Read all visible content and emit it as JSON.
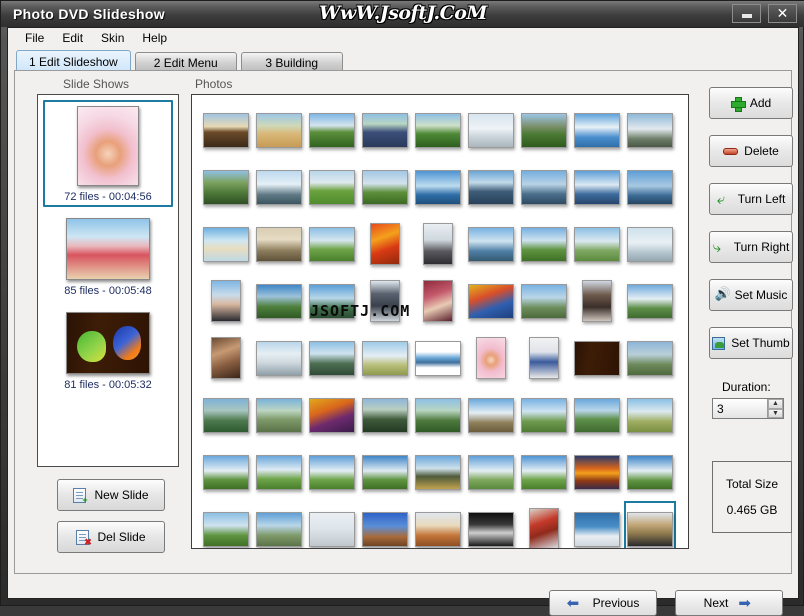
{
  "window": {
    "title": "Photo DVD Slideshow",
    "watermark_top": "WwW.JsoftJ.CoM",
    "watermark_grid": "JSOFTJ.COM",
    "minimize_label": "minimize",
    "close_label": "✕"
  },
  "menu": {
    "items": [
      "File",
      "Edit",
      "Skin",
      "Help"
    ]
  },
  "tabs": [
    {
      "label": "1 Edit Slideshow",
      "active": true
    },
    {
      "label": "2 Edit Menu",
      "active": false
    },
    {
      "label": "3 Building",
      "active": false
    }
  ],
  "labels": {
    "slideshows": "Slide Shows",
    "photos": "Photos"
  },
  "slideshows": [
    {
      "caption": "72 files - 00:04:56",
      "selected": true,
      "thumb": "girl-portrait",
      "orientation": "portrait"
    },
    {
      "caption": "85 files - 00:05:48",
      "selected": false,
      "thumb": "beach-couple",
      "orientation": "landscape"
    },
    {
      "caption": "81 files - 00:05:32",
      "selected": false,
      "thumb": "parrots",
      "orientation": "landscape"
    }
  ],
  "left_buttons": [
    {
      "label": "New Slide",
      "icon": "new-document-icon"
    },
    {
      "label": "Del Slide",
      "icon": "delete-document-icon"
    }
  ],
  "right_buttons": [
    {
      "label": "Add",
      "icon": "plus-icon"
    },
    {
      "label": "Delete",
      "icon": "minus-icon"
    },
    {
      "label": "Turn Left",
      "icon": "arrow-left-icon"
    },
    {
      "label": "Turn Right",
      "icon": "arrow-right-icon"
    },
    {
      "label": "Set Music",
      "icon": "speaker-icon"
    },
    {
      "label": "Set Thumb",
      "icon": "thumbnail-icon"
    }
  ],
  "duration": {
    "label": "Duration:",
    "value": "3",
    "spin_up": "▲",
    "spin_down": "▼"
  },
  "total_size": {
    "title": "Total Size",
    "value": "0.465 GB"
  },
  "nav": {
    "previous": "Previous",
    "next": "Next"
  },
  "photo_grid": {
    "columns": 9,
    "rows": 8,
    "count": 72,
    "selected_index": 71,
    "cells": [
      {
        "o": "land",
        "c": "linear-gradient(180deg,#9fc4e2 0%,#e8d9b4 38%,#6b4a2a 55%,#3b2a18 100%)"
      },
      {
        "o": "land",
        "c": "linear-gradient(180deg,#9cc6e6 0%,#cfd9b9 35%,#d9b878 60%,#c79b55 100%)"
      },
      {
        "o": "land",
        "c": "linear-gradient(180deg,#7fb6e4 0%,#d5e4ef 35%,#5c8f3a 55%,#2f6320 100%)"
      },
      {
        "o": "land",
        "c": "linear-gradient(180deg,#8dc0e3 0%,#b9d6c2 30%,#3c4f7a 55%,#2a3a5c 100%)"
      },
      {
        "o": "land",
        "c": "linear-gradient(180deg,#8dc0e3 0%,#cfe0c9 35%,#4e8a36 60%,#2d5e1f 100%)"
      },
      {
        "o": "land",
        "c": "linear-gradient(180deg,#d8e4ee 0%,#eef3f7 45%,#c9d3d9 70%,#aab6bd 100%)"
      },
      {
        "o": "land",
        "c": "linear-gradient(180deg,#9cc6e6 0%,#7a8f6a 38%,#4b7a33 62%,#2e5a1e 100%)"
      },
      {
        "o": "land",
        "c": "linear-gradient(180deg,#5fa3dc 0%,#e9f1f6 40%,#4b8fd0 70%,#2f6ea8 100%)"
      },
      {
        "o": "land",
        "c": "linear-gradient(180deg,#8db8d8 0%,#e2e9ee 45%,#6e7f6a 75%,#4a5744 100%)"
      },
      {
        "o": "land",
        "c": "linear-gradient(180deg,#8fc0e2 0%,#7da25e 35%,#4e7a3a 65%,#2e4f24 100%)"
      },
      {
        "o": "land",
        "c": "linear-gradient(180deg,#bcd9ef 0%,#e5eff6 40%,#5f7a86 72%,#3a5460 100%)"
      },
      {
        "o": "land",
        "c": "linear-gradient(180deg,#b9d6ea 0%,#dfe9ef 35%,#6ba23f 60%,#4f8c2d 100%)"
      },
      {
        "o": "land",
        "c": "linear-gradient(180deg,#a3c8e4 0%,#d3e2ec 38%,#5c8f3a 65%,#3b6a24 100%)"
      },
      {
        "o": "land",
        "c": "linear-gradient(180deg,#4e94d4 0%,#bddcee 45%,#2f6ea8 72%,#1f4f7c 100%)"
      },
      {
        "o": "land",
        "c": "linear-gradient(180deg,#6aa5d6 0%,#c3dbea 35%,#3e5d78 62%,#27405a 100%)"
      },
      {
        "o": "land",
        "c": "linear-gradient(180deg,#74aede 0%,#b9d3e6 40%,#4a6f8c 70%,#2e4a62 100%)"
      },
      {
        "o": "land",
        "c": "linear-gradient(180deg,#5e9fd8 0%,#dbe9f3 42%,#3d6c9c 70%,#27456c 100%)"
      },
      {
        "o": "land",
        "c": "linear-gradient(180deg,#5d9ed6 0%,#a8c9e2 45%,#3b6a94 75%,#254662 100%)"
      },
      {
        "o": "land",
        "c": "linear-gradient(180deg,#6fb1e0 0%,#cfe7f2 38%,#e8ddc0 62%,#bfd9e6 100%)"
      },
      {
        "o": "land",
        "c": "linear-gradient(180deg,#d9cdb2 0%,#e6dcc4 35%,#8f7f5e 68%,#5e5238 100%)"
      },
      {
        "o": "land",
        "c": "linear-gradient(180deg,#8cc0e4 0%,#d6e6ef 38%,#6ea449 65%,#4a7f2c 100%)"
      },
      {
        "o": "port",
        "c": "linear-gradient(160deg,#e84b1c 0%,#f4a11c 35%,#d93a14 62%,#8f2a0c 100%)"
      },
      {
        "o": "port",
        "c": "linear-gradient(180deg,#e9eef2 0%,#cfd8de 40%,#5a5a5e 68%,#2e2e32 100%)"
      },
      {
        "o": "land",
        "c": "linear-gradient(180deg,#79b2e2 0%,#cfe4f0 40%,#4f7fa6 70%,#33596f 100%)"
      },
      {
        "o": "land",
        "c": "linear-gradient(180deg,#77b0e0 0%,#cfe3ef 38%,#5e9440 66%,#3f7026 100%)"
      },
      {
        "o": "land",
        "c": "linear-gradient(180deg,#8cc0e4 0%,#dbe9f0 40%,#7fa862 68%,#5a8a3e 100%)"
      },
      {
        "o": "land",
        "c": "linear-gradient(180deg,#cfe1ec 0%,#e9f0f4 45%,#b9c9d2 72%,#94a6b0 100%)"
      },
      {
        "o": "port",
        "c": "linear-gradient(180deg,#7fb5e2 0%,#c8dcea 35%,#d9b8a0 58%,#2a2a30 100%)"
      },
      {
        "o": "land",
        "c": "linear-gradient(180deg,#3f86c8 0%,#9cc2d8 35%,#4e7f3c 66%,#2f5a24 100%)"
      },
      {
        "o": "land",
        "c": "linear-gradient(180deg,#59a0d8 0%,#b8d6e8 40%,#3f6f4a 70%,#2a4c32 100%)"
      },
      {
        "o": "port",
        "c": "linear-gradient(180deg,#dfe7ee 0%,#5a6270 32%,#3a414c 62%,#cfd6dc 100%)"
      },
      {
        "o": "port",
        "c": "linear-gradient(160deg,#8e2b3c 0%,#c45a6c 35%,#e8cbb4 62%,#5a1f2c 100%)"
      },
      {
        "o": "land",
        "c": "linear-gradient(160deg,#e2b31c 0%,#d94e2a 35%,#2f5fb0 65%,#1f3f7c 100%)"
      },
      {
        "o": "land",
        "c": "linear-gradient(180deg,#79b2e2 0%,#b9d6e8 38%,#6e8f5c 68%,#4a6a3c 100%)"
      },
      {
        "o": "port",
        "c": "linear-gradient(180deg,#cfd8e2 0%,#6e5a4c 35%,#3a2e28 65%,#cfc6be 100%)"
      },
      {
        "o": "land",
        "c": "linear-gradient(180deg,#6fa9dc 0%,#e4eef4 42%,#5e8f4a 70%,#3f6a30 100%)"
      },
      {
        "o": "port",
        "c": "linear-gradient(160deg,#6b4a34 0%,#c79a74 35%,#8a5f42 62%,#3a2618 100%)"
      },
      {
        "o": "land",
        "c": "linear-gradient(180deg,#b9d6ea 0%,#e6eef4 35%,#cfd9de 62%,#8fa0aa 100%)"
      },
      {
        "o": "land",
        "c": "linear-gradient(180deg,#8cc0e4 0%,#cfe3ef 35%,#4e6f52 65%,#2f4a36 100%)"
      },
      {
        "o": "land",
        "c": "linear-gradient(180deg,#9ecbe8 0%,#e4eef4 42%,#b9bf7a 70%,#8f9a4e 100%)"
      },
      {
        "o": "land",
        "c": "linear-gradient(180deg,#ffffff 0%,#ffffff 30%,#6aa8d8 48%,#3f6f9c 62%,#ffffff 78%)"
      },
      {
        "o": "port",
        "c": "radial-gradient(circle at 50% 55%,#f7d6bc 0%,#e8a07a 20%,#f2bccd 45%,#f8dde8 100%)"
      },
      {
        "o": "port",
        "c": "linear-gradient(180deg,#f2f2f2 0%,#dfe4ea 35%,#3a5a9c 60%,#e8e8e8 100%)"
      },
      {
        "o": "land",
        "c": "linear-gradient(100deg,#2a1205 0%,#3d1d06 35%,#2e1304 100%)"
      },
      {
        "o": "land",
        "c": "linear-gradient(180deg,#8fb6d8 0%,#b9cfd8 38%,#6e8a5c 68%,#4e6a3e 100%)"
      },
      {
        "o": "land",
        "c": "linear-gradient(180deg,#7fb2d8 0%,#a8c6c0 35%,#4e7a4e 65%,#2f5a32 100%)"
      },
      {
        "o": "land",
        "c": "linear-gradient(180deg,#7ab2dc 0%,#bcd6c2 35%,#7f9a6a 62%,#5a7248 100%)"
      },
      {
        "o": "land",
        "c": "linear-gradient(160deg,#e2a81c 0%,#d9661c 35%,#6e2a6e 62%,#3a1c4a 100%)"
      },
      {
        "o": "land",
        "c": "linear-gradient(180deg,#8fb6d8 0%,#b9cfc0 32%,#3f5a3a 62%,#243a24 100%)"
      },
      {
        "o": "land",
        "c": "linear-gradient(180deg,#8cc0e4 0%,#b9d6c2 35%,#4e7a3e 65%,#2f5a26 100%)"
      },
      {
        "o": "land",
        "c": "linear-gradient(180deg,#6aa8dc 0%,#e4eef4 42%,#8f7f5a 72%,#6a5c3c 100%)"
      },
      {
        "o": "land",
        "c": "linear-gradient(180deg,#79b2e2 0%,#cfe4f0 38%,#6e9a4e 68%,#4e7a34 100%)"
      },
      {
        "o": "land",
        "c": "linear-gradient(180deg,#6aa8dc 0%,#b9d6e8 35%,#5e8f4a 62%,#3f6a30 100%)"
      },
      {
        "o": "land",
        "c": "linear-gradient(180deg,#8cc0e4 0%,#dbe9f0 38%,#9fae62 68%,#7a8f42 100%)"
      },
      {
        "o": "land",
        "c": "linear-gradient(180deg,#6aa8dc 0%,#e4eef4 45%,#5e9440 72%,#3f7026 100%)"
      },
      {
        "o": "land",
        "c": "linear-gradient(180deg,#6aa8dc 0%,#dfeaf2 42%,#6ea449 70%,#4a7f2c 100%)"
      },
      {
        "o": "land",
        "c": "linear-gradient(180deg,#5e9fd8 0%,#e4eef4 45%,#6ea449 72%,#4a7f2c 100%)"
      },
      {
        "o": "land",
        "c": "linear-gradient(180deg,#3f86c8 0%,#dfeaf2 45%,#5e9440 72%,#3f7026 100%)"
      },
      {
        "o": "land",
        "c": "linear-gradient(180deg,#6aa8dc 0%,#cfe0ea 38%,#4e5a3a 62%,#bfa24e 100%)"
      },
      {
        "o": "land",
        "c": "linear-gradient(180deg,#5e9fd8 0%,#e4eef4 45%,#7fa85e 72%,#5a8a3e 100%)"
      },
      {
        "o": "land",
        "c": "linear-gradient(180deg,#4e94d4 0%,#e4eef4 45%,#6ea449 72%,#4a7f2c 100%)"
      },
      {
        "o": "land",
        "c": "linear-gradient(180deg,#2a3a6a 0%,#d9661c 38%,#f4a11c 52%,#8f3a14 75%,#3a2a4a 100%)"
      },
      {
        "o": "land",
        "c": "linear-gradient(180deg,#3f86c8 0%,#e4eef4 45%,#5e9440 75%,#3f7026 100%)"
      },
      {
        "o": "land",
        "c": "linear-gradient(180deg,#8cc0e4 0%,#cfe3ef 38%,#5e9440 68%,#3f7026 100%)"
      },
      {
        "o": "land",
        "c": "linear-gradient(180deg,#5e9fd8 0%,#b9d6e8 38%,#7f9a6a 68%,#5a7248 100%)"
      },
      {
        "o": "land",
        "c": "linear-gradient(180deg,#e9eef2 0%,#dfe6ec 45%,#cfd6dc 75%,#bfc6cc 100%)"
      },
      {
        "o": "land",
        "c": "linear-gradient(180deg,#2f62c8 0%,#5a8fd8 40%,#a86a3a 72%,#6e4424 100%)"
      },
      {
        "o": "land",
        "c": "linear-gradient(180deg,#dfe6ec 0%,#e8d9bc 38%,#c4763a 68%,#8f4e24 100%)"
      },
      {
        "o": "land",
        "c": "linear-gradient(180deg,#0e0e0e 0%,#3a3a3a 35%,#cfcfcf 60%,#1a1a1a 100%)"
      },
      {
        "o": "port",
        "c": "linear-gradient(160deg,#d9d2c8 0%,#c43a2a 35%,#8f2a1c 58%,#dfe4ea 100%)"
      },
      {
        "o": "land",
        "c": "linear-gradient(180deg,#2f6ea8 0%,#4a8fc8 42%,#e9eef2 70%,#cfd8de 100%)"
      },
      {
        "o": "land",
        "c": "linear-gradient(180deg,#dfe6ec 0%,#c4a87a 35%,#8f7a4e 62%,#2a2a2a 100%)"
      }
    ]
  }
}
